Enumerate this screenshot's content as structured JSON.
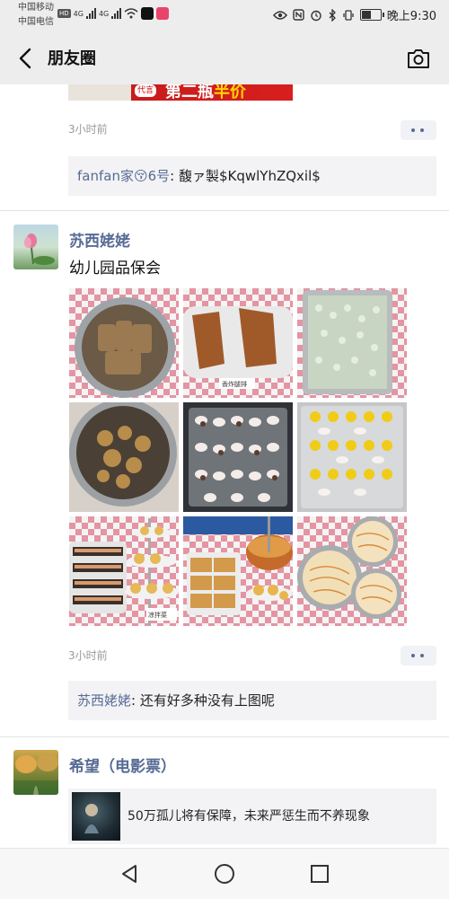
{
  "status_bar": {
    "carrier1": "中国移动",
    "carrier2": "中国电信",
    "hd_badge": "HD",
    "net1": "4G",
    "net2": "4G",
    "time": "晚上9:30",
    "battery_level": 0.55
  },
  "header": {
    "title": "朋友圈"
  },
  "posts": [
    {
      "image_text": {
        "tag": "代言",
        "big_prefix": "第二瓶",
        "big_yellow": "半价"
      },
      "time": "3小时前",
      "comment": {
        "name": "fanfan家😚6号",
        "text": ": 馥ァ製$KqwlYhZQxil$"
      }
    },
    {
      "name": "苏西姥姥",
      "text": "幼儿园品保会",
      "time": "3小时前",
      "photo_labels": [
        "香炸腿排",
        "凉拌菜"
      ],
      "comment": {
        "name": "苏西姥姥",
        "text": ": 还有好多种没有上图呢"
      }
    },
    {
      "name": "希望（电影票）",
      "share_title": "50万孤儿将有保障，未来严惩生而不养现象"
    }
  ],
  "colors": {
    "link": "#576b95",
    "header_bg": "#ededed",
    "comment_bg": "#f3f3f5",
    "timestamp": "#9a9a9a"
  },
  "icons": [
    "back-arrow-icon",
    "camera-icon",
    "more-dots-icon",
    "nav-back-icon",
    "nav-home-icon",
    "nav-recents-icon"
  ]
}
